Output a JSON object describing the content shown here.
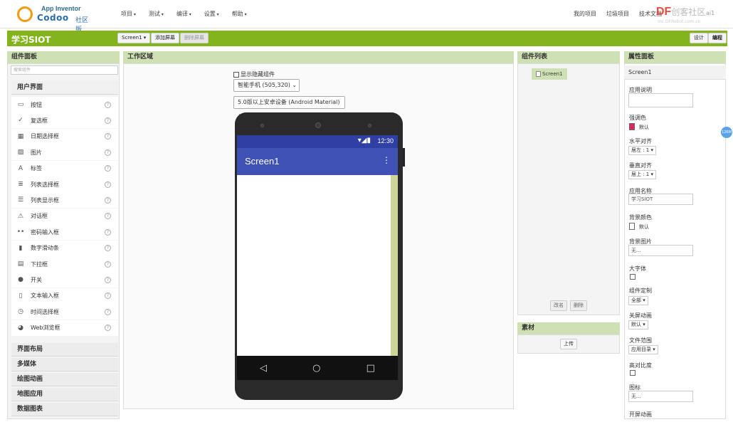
{
  "header": {
    "logo_title": "App Inventor",
    "logo_brand": "Codoo",
    "logo_sub": "社区版",
    "menu": [
      "项目",
      "测试",
      "编译",
      "设置",
      "帮助"
    ],
    "links": [
      "我的项目",
      "垃圾项目",
      "技术文档"
    ],
    "df_brand": "DF",
    "df_brand_rest": "创客社区",
    "df_sub": "mc.DFRobot.com.cn",
    "user_edge": "ai1"
  },
  "toolbar": {
    "project_title": "学习SIOT",
    "screen_select": "Screen1 ▾",
    "add_screen": "添加屏幕",
    "remove_screen": "删除屏幕",
    "designer": "设计",
    "blocks": "编程"
  },
  "palette": {
    "title": "组件面板",
    "search_placeholder": "搜索组件",
    "category_open": "用户界面",
    "items": [
      {
        "label": "按钮",
        "icon": "button-icon"
      },
      {
        "label": "复选框",
        "icon": "checkbox-icon"
      },
      {
        "label": "日期选择框",
        "icon": "calendar-icon"
      },
      {
        "label": "图片",
        "icon": "image-icon"
      },
      {
        "label": "标签",
        "icon": "label-icon"
      },
      {
        "label": "列表选择框",
        "icon": "listpicker-icon"
      },
      {
        "label": "列表显示框",
        "icon": "listview-icon"
      },
      {
        "label": "对话框",
        "icon": "notifier-icon"
      },
      {
        "label": "密码输入框",
        "icon": "password-icon"
      },
      {
        "label": "数字滑动条",
        "icon": "slider-icon"
      },
      {
        "label": "下拉框",
        "icon": "spinner-icon"
      },
      {
        "label": "开关",
        "icon": "switch-icon"
      },
      {
        "label": "文本输入框",
        "icon": "textbox-icon"
      },
      {
        "label": "时间选择框",
        "icon": "clock-icon"
      },
      {
        "label": "Web浏览框",
        "icon": "web-icon"
      }
    ],
    "help_glyph": "?",
    "categories": [
      "界面布局",
      "多媒体",
      "绘图动画",
      "地图应用",
      "数据图表"
    ]
  },
  "viewer": {
    "title": "工作区域",
    "show_hidden": "显示隐藏组件",
    "device_select": "智能手机 (505,320)",
    "theme_select": "5.0版以上安卓设备 (Android Material)",
    "status_time": "12:30",
    "screen_title": "Screen1",
    "menu_glyph": "⋮",
    "nav_back": "◁",
    "nav_home": "○",
    "nav_recent": "□"
  },
  "components": {
    "title": "组件列表",
    "tree_item": "Screen1",
    "rename": "改名",
    "delete": "删除"
  },
  "media": {
    "title": "素材",
    "upload": "上传"
  },
  "properties": {
    "title": "属性面板",
    "component": "Screen1",
    "about_label": "应用说明",
    "accent_label": "强调色",
    "accent_value": "默认",
    "accent_color": "#e0245e",
    "halign_label": "水平对齐",
    "halign_value": "居左 : 1 ▾",
    "valign_label": "垂直对齐",
    "valign_value": "居上 : 1 ▾",
    "appname_label": "应用名称",
    "appname_value": "学习SIOT",
    "bgcolor_label": "背景颜色",
    "bgcolor_value": "默认",
    "bgimage_label": "背景图片",
    "bgimage_value": "无...",
    "bigfont_label": "大字体",
    "blocks_label": "组件定制",
    "blocks_value": "全部 ▾",
    "closeanim_label": "关屏动画",
    "closeanim_value": "默认 ▾",
    "filescope_label": "文件范围",
    "filescope_value": "应用目录 ▾",
    "contrast_label": "高对比度",
    "icon_label": "图标",
    "icon_value": "无...",
    "openanim_label": "开屏动画"
  },
  "side_badge": "126M",
  "colors": {
    "green": "#84b41c",
    "panel_head": "#cfe0b4",
    "appbar": "#3f51b5",
    "statusbar": "#2f3fa3"
  }
}
